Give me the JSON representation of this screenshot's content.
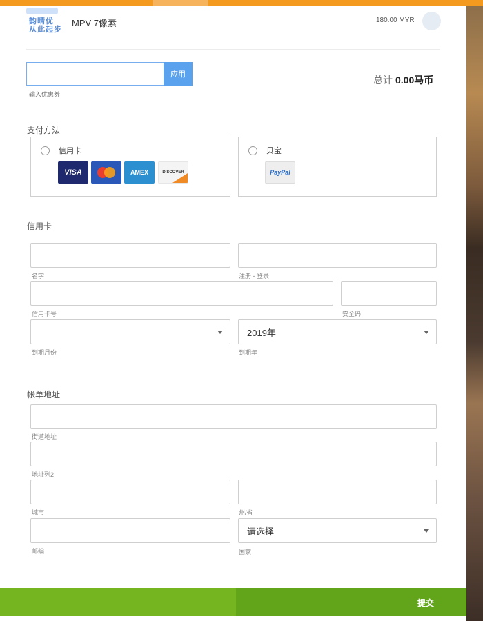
{
  "header": {
    "logo_text": "韵晴优\n从此起步",
    "product_name": "MPV 7像素",
    "price": "180.00 MYR"
  },
  "coupon": {
    "value": "",
    "placeholder": "",
    "apply_label": "应用",
    "caption": "输入优惠券"
  },
  "total": {
    "label": "总计",
    "amount": "0.00马币"
  },
  "payment": {
    "title": "支付方法",
    "credit_card_label": "信用卡",
    "paypal_label": "贝宝",
    "card_logos": [
      "VISA",
      "mastercard",
      "AMEX",
      "DISCOVER"
    ],
    "paypal_logo": "PayPal"
  },
  "card_section": {
    "title": "信用卡",
    "name_caption": "名字",
    "register_caption": "注册 - 登录",
    "card_number_caption": "信用卡号",
    "cvv_caption": "安全码",
    "exp_month_caption": "到期月份",
    "exp_month_value": "",
    "exp_year_caption": "到期年",
    "exp_year_value": "2019年"
  },
  "billing": {
    "title": "帐单地址",
    "street_caption": "街道地址",
    "address2_caption": "地址列2",
    "city_caption": "城市",
    "state_caption": "州/省",
    "zip_caption": "邮编",
    "country_caption": "国家",
    "country_value": "请选择"
  },
  "footer": {
    "submit_label": "提交"
  },
  "colors": {
    "accent_orange": "#f39a1f",
    "apply_blue": "#5aa2ee",
    "submit_green": "#62a51a"
  }
}
